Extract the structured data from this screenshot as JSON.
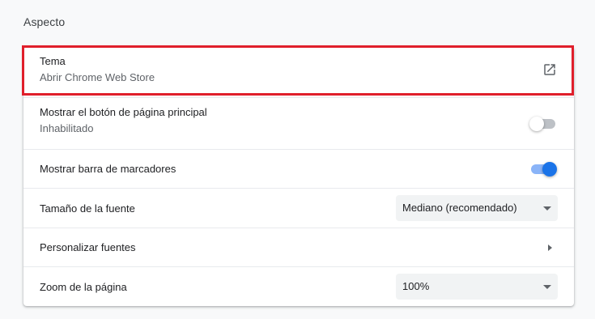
{
  "section": {
    "title": "Aspecto"
  },
  "rows": {
    "theme": {
      "label": "Tema",
      "sub": "Abrir Chrome Web Store",
      "icon": "open-in-new-icon"
    },
    "home_button": {
      "label": "Mostrar el botón de página principal",
      "sub": "Inhabilitado",
      "enabled": false
    },
    "bookmarks_bar": {
      "label": "Mostrar barra de marcadores",
      "enabled": true
    },
    "font_size": {
      "label": "Tamaño de la fuente",
      "value": "Mediano (recomendado)"
    },
    "customize_fonts": {
      "label": "Personalizar fuentes",
      "icon": "chevron-right-icon"
    },
    "page_zoom": {
      "label": "Zoom de la página",
      "value": "100%"
    }
  },
  "colors": {
    "highlight_border": "#e01f2b",
    "toggle_on": "#1a73e8",
    "toggle_off": "#bdc1c6"
  }
}
